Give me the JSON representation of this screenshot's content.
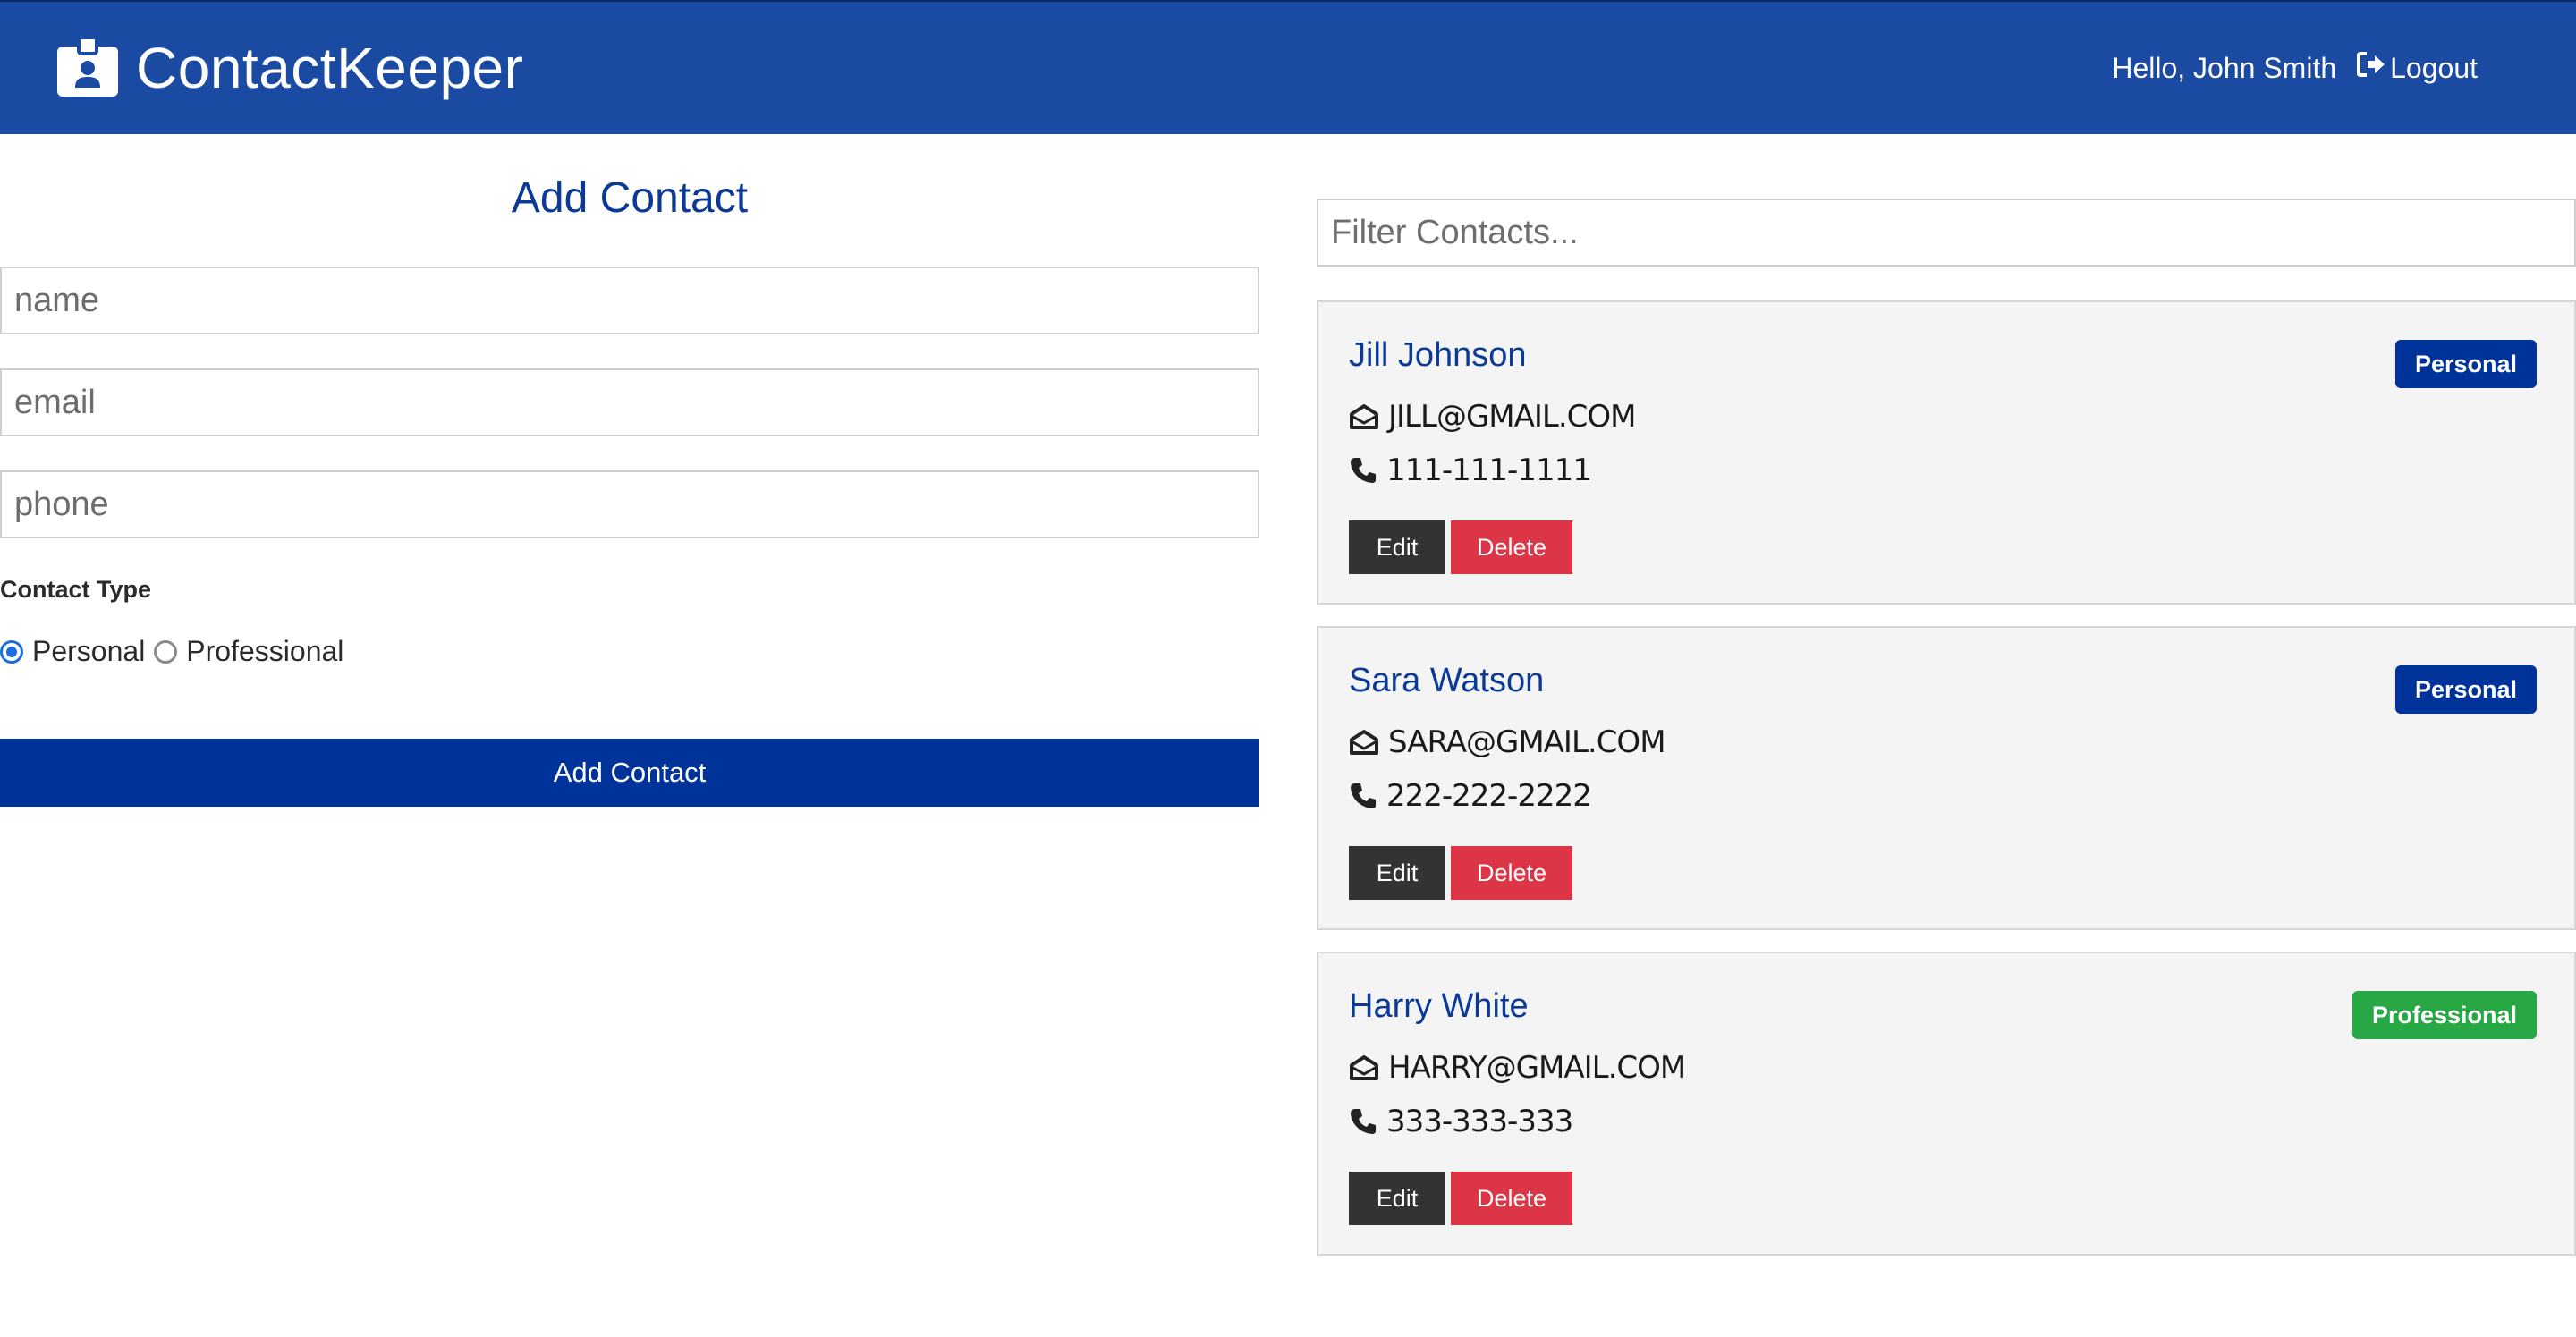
{
  "app": {
    "title": "ContactKeeper",
    "icon": "id-badge-icon"
  },
  "navbar": {
    "greeting": "Hello, John Smith",
    "logout_label": "Logout",
    "logout_icon": "sign-out-icon",
    "background": "#1b4aa3"
  },
  "form": {
    "title": "Add Contact",
    "name_placeholder": "name",
    "email_placeholder": "email",
    "phone_placeholder": "phone",
    "type_label": "Contact Type",
    "type_options": [
      {
        "label": "Personal",
        "checked": true
      },
      {
        "label": "Professional",
        "checked": false
      }
    ],
    "submit_label": "Add Contact"
  },
  "filter": {
    "placeholder": "Filter Contacts..."
  },
  "contacts": [
    {
      "name": "Jill Johnson",
      "email": "JILL@GMAIL.COM",
      "phone": "111-111-1111",
      "type": "Personal",
      "type_color": "#003399",
      "edit_label": "Edit",
      "delete_label": "Delete"
    },
    {
      "name": "Sara Watson",
      "email": "SARA@GMAIL.COM",
      "phone": "222-222-2222",
      "type": "Personal",
      "type_color": "#003399",
      "edit_label": "Edit",
      "delete_label": "Delete"
    },
    {
      "name": "Harry White",
      "email": "HARRY@GMAIL.COM",
      "phone": "333-333-333",
      "type": "Professional",
      "type_color": "#28a745",
      "edit_label": "Edit",
      "delete_label": "Delete"
    }
  ],
  "colors": {
    "primary": "#003399",
    "danger": "#dc3545",
    "success": "#28a745",
    "dark": "#333333"
  }
}
